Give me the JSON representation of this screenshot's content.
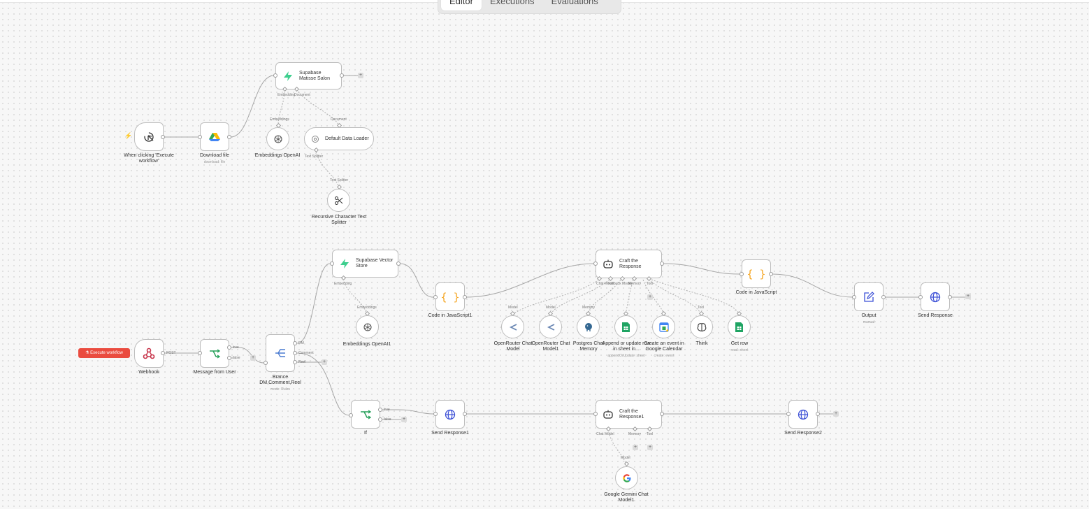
{
  "tabs": {
    "editor": "Editor",
    "executions": "Executions",
    "evaluations": "Evaluations"
  },
  "execute_button": "Execute workflow",
  "nodes": {
    "manual_trigger": {
      "label": "When clicking 'Execute workflow'"
    },
    "download_file": {
      "label": "Download file",
      "sub": "download: file"
    },
    "supabase_matisse": {
      "label": "Supabase Matisse Salon",
      "ports": {
        "embedding": "Embedding",
        "document": "Document"
      }
    },
    "embeddings_openai": {
      "label": "Embeddings OpenAI",
      "port": "Embeddings"
    },
    "default_data_loader": {
      "label": "Default Data Loader",
      "port_in": "Document",
      "port_out": "Text Splitter"
    },
    "text_splitter": {
      "label": "Recursive Character Text Splitter",
      "port": "Text Splitter"
    },
    "webhook": {
      "label": "Webhook",
      "port": "POST"
    },
    "message_from_user": {
      "label": "Message from User",
      "ports": {
        "true": "true",
        "false": "false"
      }
    },
    "brance": {
      "label": "Brance DM,Comment,Reel",
      "sub": "mode: Rules",
      "ports": {
        "dm": "DM",
        "comment": "Comment",
        "reel": "Reel"
      }
    },
    "supabase_vector": {
      "label": "Supabase Vector Store",
      "port": "Embedding"
    },
    "embeddings_openai1": {
      "label": "Embeddings OpenAI1",
      "port": "Embeddings"
    },
    "code_js1": {
      "label": "Code in JavaScript1"
    },
    "craft_response": {
      "label": "Craft the Response",
      "ports": {
        "chat": "Chat Model",
        "fallback": "Fallback Model",
        "memory": "Memory",
        "tool": "Tool"
      }
    },
    "code_js": {
      "label": "Code in JavaScript"
    },
    "output": {
      "label": "Output",
      "sub": "manual"
    },
    "send_response": {
      "label": "Send Response"
    },
    "openrouter1": {
      "label": "OpenRouter Chat Model",
      "port": "Model"
    },
    "openrouter2": {
      "label": "OpenRouter Chat Model1",
      "port": "Model"
    },
    "postgres": {
      "label": "Postgres Chat Memory",
      "port": "Memory"
    },
    "sheet_append": {
      "label": "Append or update row in sheet in...",
      "sub": "appendOrUpdate: sheet"
    },
    "calendar": {
      "label": "Create an event in Google Calendar",
      "sub": "create: event"
    },
    "think": {
      "label": "Think",
      "port": "Tool"
    },
    "get_row": {
      "label": "Get row",
      "sub": "read: sheet"
    },
    "if_node": {
      "label": "If",
      "ports": {
        "true": "true",
        "false": "false"
      }
    },
    "send_response1": {
      "label": "Send Response1"
    },
    "craft_response1": {
      "label": "Craft the Response1",
      "ports": {
        "chat": "Chat Model",
        "memory": "Memory",
        "tool": "Tool"
      }
    },
    "send_response2": {
      "label": "Send Response2"
    },
    "gemini": {
      "label": "Google Gemini Chat Model1",
      "port": "Model"
    }
  },
  "colors": {
    "accent": "#ea4b3f",
    "supabase": "#3ecf8e",
    "code": "#f5a623",
    "globe": "#3b4fd6",
    "sheets": "#1fa463",
    "if_green": "#27a05a"
  }
}
